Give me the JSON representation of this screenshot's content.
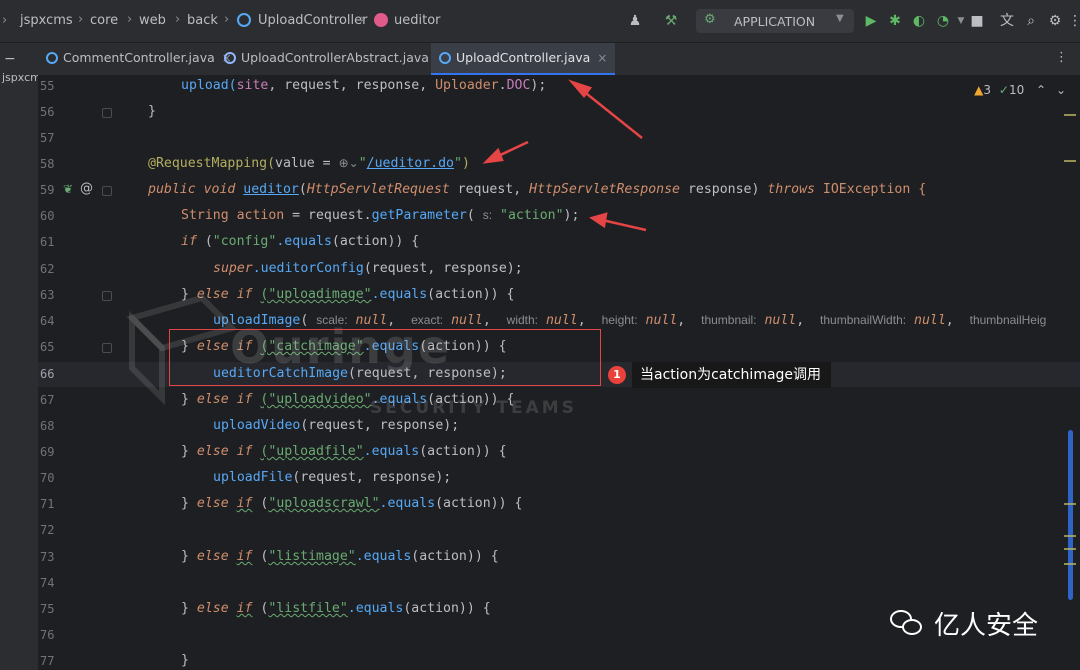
{
  "breadcrumb": {
    "items": [
      "jspxcms",
      "core",
      "web",
      "back",
      "UploadController",
      "ueditor"
    ]
  },
  "toolbar": {
    "run_config": "APPLICATION"
  },
  "tabs": [
    {
      "label": "CommentController.java",
      "active": false
    },
    {
      "label": "UploadControllerAbstract.java",
      "active": false
    },
    {
      "label": "UploadController.java",
      "active": true
    }
  ],
  "project_label": "jspxcm",
  "inspections": {
    "warnings": "3",
    "checks": "10"
  },
  "lines": [
    "55",
    "56",
    "57",
    "58",
    "59",
    "60",
    "61",
    "62",
    "63",
    "64",
    "65",
    "66",
    "67",
    "68",
    "69",
    "70",
    "71",
    "72",
    "73",
    "74",
    "75",
    "76",
    "77"
  ],
  "code": {
    "l55": {
      "a": "upload(",
      "b": "site",
      ",": ", request, response, ",
      "c": "Uploader",
      "d": ".",
      "e": "DOC",
      "f": ");"
    },
    "l56": "}",
    "l58": {
      "ann": "@RequestMapping(",
      "attr": "value = ",
      "path": "/ueditor.do",
      "q1": "\"",
      "q2": "\"",
      "end": ")"
    },
    "l59": {
      "kw1": "public void ",
      "fn": "ueditor",
      "p1": "(",
      "t1": "HttpServletRequest",
      "p2": " request, ",
      "t2": "HttpServletResponse",
      "p3": " response) ",
      "kw2": "throws ",
      "ex": "IOException {"
    },
    "l60": {
      "t": "String ",
      "v": "action",
      "eq": " = request.",
      "m": "getParameter",
      "p": "( ",
      "hint": "s:",
      "s": " \"action\"",
      "e": ");"
    },
    "l61": {
      "kw": "if ",
      "s": "\"config\"",
      "m": ".equals",
      "r": "(action)) {"
    },
    "l62": {
      "kw": "super",
      "m": ".ueditorConfig",
      "r": "(request, response);"
    },
    "l63": {
      "b": "} ",
      "kw": "else if ",
      "s": "(\"uploadimage\"",
      "m": ".equals",
      "r": "(action)) {"
    },
    "l64": {
      "m": "uploadImage",
      "p": "( ",
      "h1": "scale:",
      "n1": " null",
      ",1": ",  ",
      "h2": "exact:",
      "n2": " null",
      ",2": ",  ",
      "h3": "width:",
      "n3": " null",
      ",3": ",  ",
      "h4": "height:",
      "n4": " null",
      ",4": ",  ",
      "h5": "thumbnail:",
      "n5": " null",
      ",5": ",  ",
      "h6": "thumbnailWidth:",
      "n6": " null",
      ",6": ",  ",
      "h7": "thumbnailHeig"
    },
    "l65": {
      "b": "} ",
      "kw": "else if ",
      "s": "(\"catchimage\"",
      "m": ".equals",
      "r": "(action)) {"
    },
    "l66": {
      "m": "ueditorCatchImage",
      "r": "(request, response);"
    },
    "l67": {
      "b": "} ",
      "kw": "else if ",
      "s": "(\"uploadvideo\"",
      "m": ".equals",
      "r": "(action)) {"
    },
    "l68": {
      "m": "uploadVideo",
      "r": "(request, response);"
    },
    "l69": {
      "b": "} ",
      "kw": "else if ",
      "s": "(\"uploadfile\"",
      "m": ".equals",
      "r": "(action)) {"
    },
    "l70": {
      "m": "uploadFile",
      "r": "(request, response);"
    },
    "l71": {
      "b": "} ",
      "kw1": "else ",
      "kw2": "if",
      "sp": " (",
      "s": "\"uploadscrawl\"",
      "m": ".equals",
      "r": "(action)) {"
    },
    "l73": {
      "b": "} ",
      "kw1": "else ",
      "kw2": "if",
      "sp": " (",
      "s": "\"listimage\"",
      "m": ".equals",
      "r": "(action)) {"
    },
    "l75": {
      "b": "} ",
      "kw1": "else ",
      "kw2": "if",
      "sp": " (",
      "s": "\"listfile\"",
      "m": ".equals",
      "r": "(action)) {"
    },
    "l77": "}"
  },
  "callout": {
    "number": "1",
    "text": "当action为catchimage调用"
  },
  "watermark": {
    "big": "Ouringe",
    "small": "SECURITY TEAMS"
  },
  "brand": {
    "name": "亿人安全"
  },
  "colors": {
    "bg_editor": "#1e1f22",
    "keyword": "#cf8e6d",
    "string": "#6aab73",
    "method": "#56a8f5",
    "annotation_red": "#e54545"
  }
}
